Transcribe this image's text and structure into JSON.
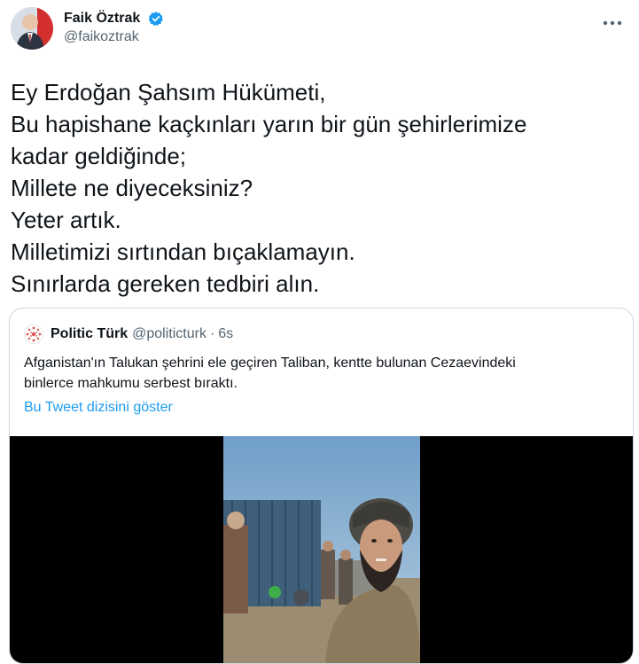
{
  "author": {
    "name": "Faik Öztrak",
    "handle": "@faikoztrak"
  },
  "icons": {
    "verified": "verified-badge-icon",
    "more": "more-icon"
  },
  "tweet": {
    "lines": [
      "Ey Erdoğan Şahsım Hükümeti,",
      "Bu hapishane kaçkınları yarın bir gün şehirlerimize",
      "kadar geldiğinde;",
      "Millete ne diyeceksiniz?",
      "Yeter artık.",
      "Milletimizi sırtından bıçaklamayın.",
      "Sınırlarda gereken tedbiri alın."
    ]
  },
  "quote": {
    "name": "Politic Türk",
    "handle": "@politicturk",
    "separator": "·",
    "time": "6s",
    "text_lines": [
      "Afganistan'ın Talukan şehrini ele geçiren Taliban, kentte bulunan Cezaevindeki",
      "binlerce mahkumu serbest bıraktı."
    ],
    "thread_link": "Bu Tweet dizisini göster"
  },
  "colors": {
    "accent": "#1d9bf0",
    "secondary_text": "#536471",
    "border": "#cfd9de"
  }
}
